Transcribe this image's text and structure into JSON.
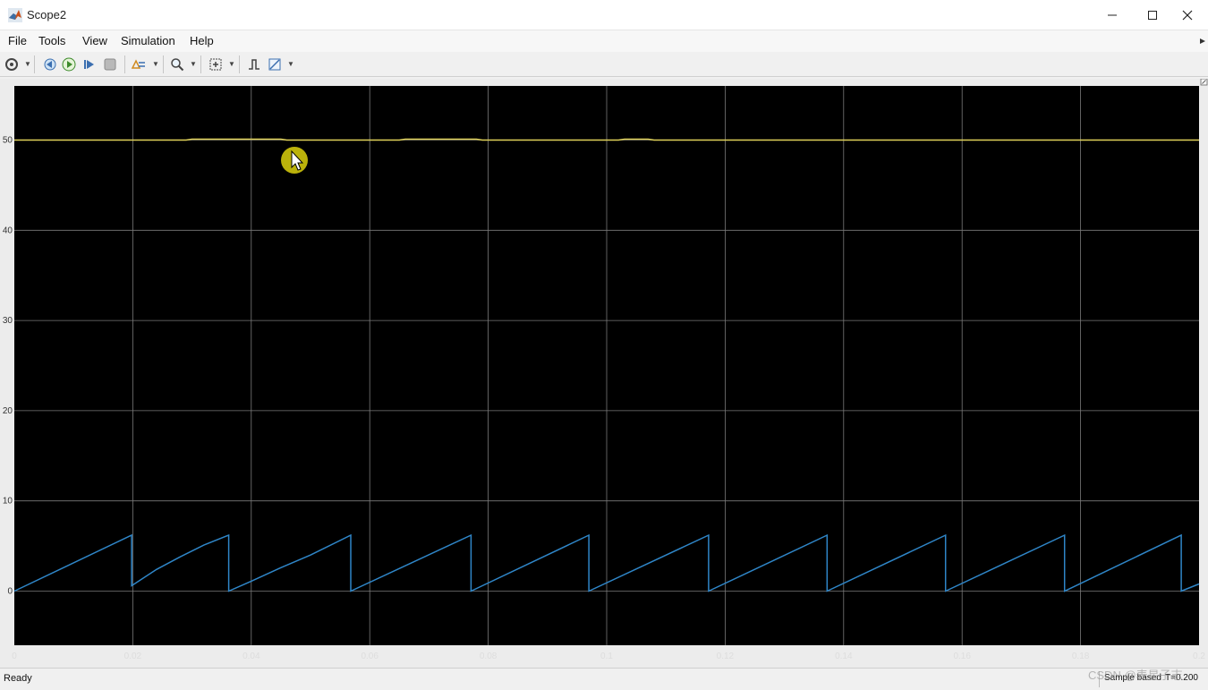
{
  "window": {
    "title": "Scope2",
    "controls": {
      "minimize": "minimize-icon",
      "maximize": "maximize-icon",
      "close": "close-icon"
    }
  },
  "menu": {
    "items": [
      {
        "label": "File"
      },
      {
        "label": "Tools"
      },
      {
        "label": "View"
      },
      {
        "label": "Simulation"
      },
      {
        "label": "Help"
      }
    ]
  },
  "toolbar": {
    "icons": [
      "settings-icon",
      "step-back-icon",
      "run-icon",
      "step-forward-icon",
      "stop-icon",
      "highlight-icon",
      "zoom-icon",
      "scale-axes-icon",
      "triggers-icon",
      "cursor-measurements-icon"
    ]
  },
  "status": {
    "left": "Ready",
    "right": "Sample based",
    "time_offset": "T=0.200"
  },
  "watermark": "CSDN @表星子志",
  "colors": {
    "plot_bg": "#000000",
    "grid": "#7a7a7a",
    "series_yellow": "#e0d25a",
    "series_blue": "#2f86c8",
    "tick_text": "#dddddd",
    "cursor_highlight": "#cfc50c"
  },
  "chart_data": {
    "type": "line",
    "xlim": [
      0,
      0.2
    ],
    "ylim": [
      -6,
      56
    ],
    "grid": true,
    "x_ticks": [
      "0",
      "0.02",
      "0.04",
      "0.06",
      "0.08",
      "0.1",
      "0.12",
      "0.14",
      "0.16",
      "0.18",
      "0.2"
    ],
    "y_ticks": [
      "0",
      "10",
      "20",
      "30",
      "40",
      "50"
    ],
    "x_tick_values": [
      0,
      0.02,
      0.04,
      0.06,
      0.08,
      0.1,
      0.12,
      0.14,
      0.16,
      0.18,
      0.2
    ],
    "y_tick_values": [
      0,
      10,
      20,
      30,
      40,
      50
    ],
    "series": [
      {
        "color": "#e0d25a",
        "x": [
          0,
          0.029,
          0.03,
          0.045,
          0.046,
          0.065,
          0.066,
          0.078,
          0.079,
          0.102,
          0.103,
          0.107,
          0.108,
          0.2
        ],
        "y": [
          50,
          50,
          50.1,
          50.1,
          50,
          50,
          50.1,
          50.1,
          50,
          50,
          50.1,
          50.1,
          50,
          50
        ]
      },
      {
        "color": "#2f86c8",
        "x": [
          0,
          0.0198,
          0.0198,
          0.024,
          0.028,
          0.032,
          0.0362,
          0.0362,
          0.04,
          0.045,
          0.05,
          0.0568,
          0.0568,
          0.0771,
          0.0771,
          0.097,
          0.097,
          0.1172,
          0.1172,
          0.1372,
          0.1372,
          0.1572,
          0.1572,
          0.1773,
          0.1773,
          0.197,
          0.197,
          0.2
        ],
        "y": [
          0,
          6.2,
          0.6,
          2.4,
          3.8,
          5.1,
          6.2,
          0,
          1.1,
          2.6,
          4.0,
          6.2,
          0,
          6.2,
          0,
          6.2,
          0,
          6.2,
          0,
          6.2,
          0,
          6.2,
          0,
          6.2,
          0,
          6.2,
          0,
          0.8
        ]
      }
    ]
  }
}
